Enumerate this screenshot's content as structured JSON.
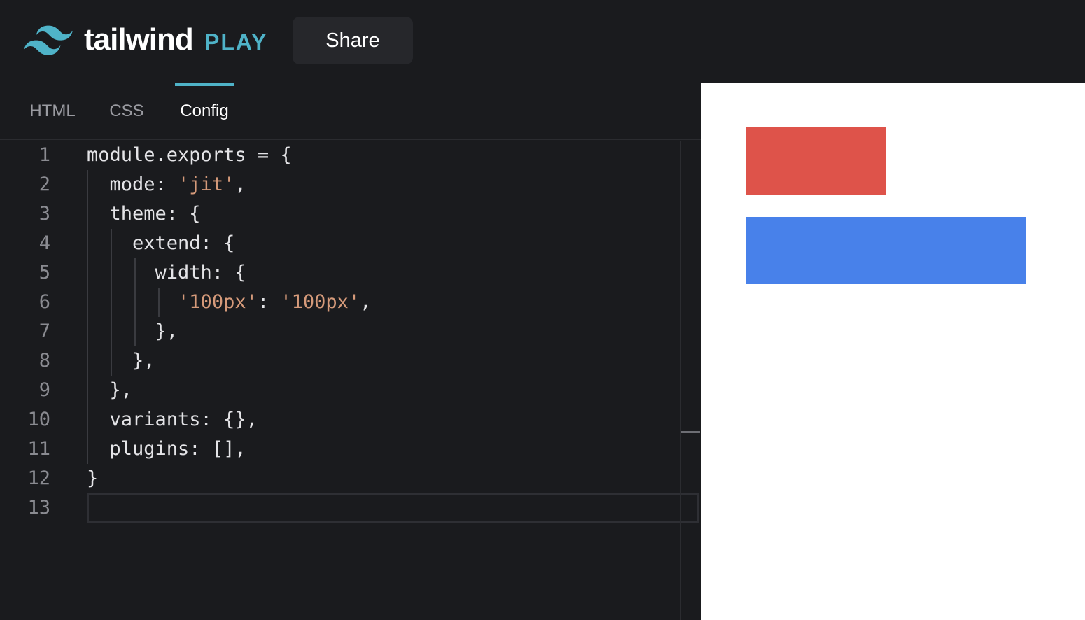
{
  "header": {
    "logo_text": "tailwind",
    "logo_sub": "PLAY",
    "share_label": "Share"
  },
  "tabs": [
    {
      "label": "HTML",
      "active": false
    },
    {
      "label": "CSS",
      "active": false
    },
    {
      "label": "Config",
      "active": true
    }
  ],
  "editor": {
    "lines": [
      {
        "n": "1",
        "segments": [
          {
            "t": "module.exports = {",
            "k": "plain"
          }
        ]
      },
      {
        "n": "2",
        "segments": [
          {
            "t": "  mode: ",
            "k": "plain"
          },
          {
            "t": "'jit'",
            "k": "str"
          },
          {
            "t": ",",
            "k": "plain"
          }
        ]
      },
      {
        "n": "3",
        "segments": [
          {
            "t": "  theme: {",
            "k": "plain"
          }
        ]
      },
      {
        "n": "4",
        "segments": [
          {
            "t": "    extend: {",
            "k": "plain"
          }
        ]
      },
      {
        "n": "5",
        "segments": [
          {
            "t": "      width: {",
            "k": "plain"
          }
        ]
      },
      {
        "n": "6",
        "segments": [
          {
            "t": "        ",
            "k": "plain"
          },
          {
            "t": "'100px'",
            "k": "str"
          },
          {
            "t": ": ",
            "k": "plain"
          },
          {
            "t": "'100px'",
            "k": "str"
          },
          {
            "t": ",",
            "k": "plain"
          }
        ]
      },
      {
        "n": "7",
        "segments": [
          {
            "t": "      },",
            "k": "plain"
          }
        ]
      },
      {
        "n": "8",
        "segments": [
          {
            "t": "    },",
            "k": "plain"
          }
        ]
      },
      {
        "n": "9",
        "segments": [
          {
            "t": "  },",
            "k": "plain"
          }
        ]
      },
      {
        "n": "10",
        "segments": [
          {
            "t": "  variants: {},",
            "k": "plain"
          }
        ]
      },
      {
        "n": "11",
        "segments": [
          {
            "t": "  plugins: [],",
            "k": "plain"
          }
        ]
      },
      {
        "n": "12",
        "segments": [
          {
            "t": "}",
            "k": "plain"
          }
        ]
      },
      {
        "n": "13",
        "segments": []
      }
    ]
  },
  "preview": {
    "boxes": [
      {
        "name": "red-box",
        "color": "#de534a"
      },
      {
        "name": "blue-box",
        "color": "#4881ea"
      }
    ]
  },
  "colors": {
    "accent": "#4fb3c8",
    "string": "#d59a7a",
    "background": "#1a1b1e"
  }
}
